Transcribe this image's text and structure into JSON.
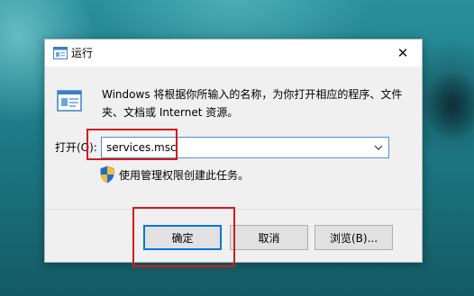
{
  "window": {
    "title": "运行",
    "close_glyph": "✕"
  },
  "content": {
    "description": "Windows 将根据你所输入的名称，为你打开相应的程序、文件夹、文档或 Internet 资源。",
    "open_label": "打开(O):",
    "input_value": "services.msc",
    "admin_note": "使用管理权限创建此任务。"
  },
  "buttons": {
    "ok": "确定",
    "cancel": "取消",
    "browse": "浏览(B)..."
  },
  "icons": {
    "title": "run-icon",
    "big": "run-icon",
    "dropdown": "chevron-down-icon",
    "shield": "uac-shield-icon"
  },
  "colors": {
    "accent": "#0078d7",
    "highlight_box": "#d21b1b"
  }
}
